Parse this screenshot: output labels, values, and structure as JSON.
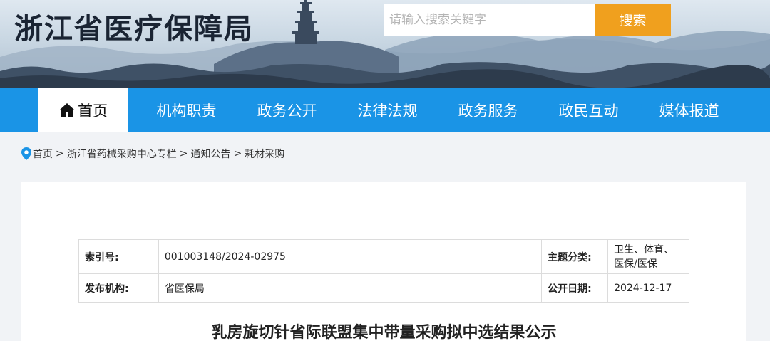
{
  "header": {
    "site_title": "浙江省医疗保障局",
    "search_placeholder": "请输入搜索关键字",
    "search_button": "搜索"
  },
  "nav": {
    "items": [
      {
        "label": "首页",
        "active": true
      },
      {
        "label": "机构职责"
      },
      {
        "label": "政务公开"
      },
      {
        "label": "法律法规"
      },
      {
        "label": "政务服务"
      },
      {
        "label": "政民互动"
      },
      {
        "label": "媒体报道"
      }
    ]
  },
  "breadcrumb": [
    "首页",
    "浙江省药械采购中心专栏",
    "通知公告",
    "耗材采购"
  ],
  "meta": {
    "index_label": "索引号:",
    "index_value": "001003148/2024-02975",
    "topic_label": "主题分类:",
    "topic_value": "卫生、体育、医保/医保",
    "publisher_label": "发布机构:",
    "publisher_value": "省医保局",
    "date_label": "公开日期:",
    "date_value": "2024-12-17"
  },
  "article": {
    "title": "乳房旋切针省际联盟集中带量采购拟中选结果公示"
  },
  "colors": {
    "nav_bg": "#1a94e6",
    "search_button": "#f0a01e",
    "page_bg": "#f1f3f6"
  }
}
